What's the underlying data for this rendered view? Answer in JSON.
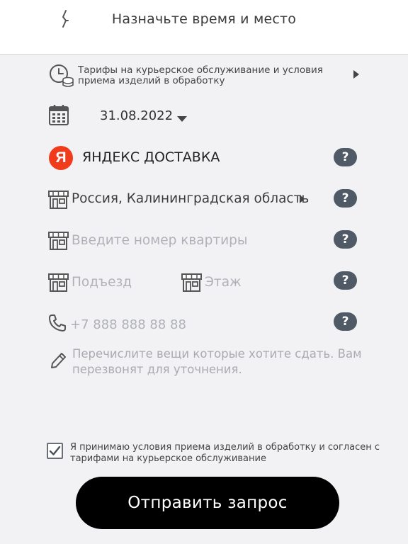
{
  "header": {
    "title": "Назначьте время и место",
    "back_icon": "back-arrow-icon"
  },
  "tariffs": {
    "text": "Тарифы на курьерское обслуживание и условия приема изделий в обработку"
  },
  "date": {
    "value": "31.08.2022"
  },
  "delivery": {
    "logo_letter": "Я",
    "name": "ЯНДЕКС ДОСТАВКА"
  },
  "region": {
    "value": "Россия, Калининградская область"
  },
  "apartment": {
    "placeholder": "Введите номер квартиры"
  },
  "entrance": {
    "placeholder": "Подъезд"
  },
  "floor": {
    "placeholder": "Этаж"
  },
  "phone": {
    "placeholder": "+7 888 888 88 88"
  },
  "notes": {
    "placeholder": "Перечислите вещи которые хотите сдать. Вам перезвонят для уточнения."
  },
  "agreement": {
    "checked": true,
    "text": "Я принимаю условия приема изделий в обработку и согласен с тарифами на курьерское обслуживание"
  },
  "submit": {
    "label": "Отправить запрос"
  },
  "help_label": "?",
  "colors": {
    "yandex_red": "#f03b1d",
    "help_badge": "#505a66",
    "button": "#000000",
    "background": "#f2f2f4"
  }
}
